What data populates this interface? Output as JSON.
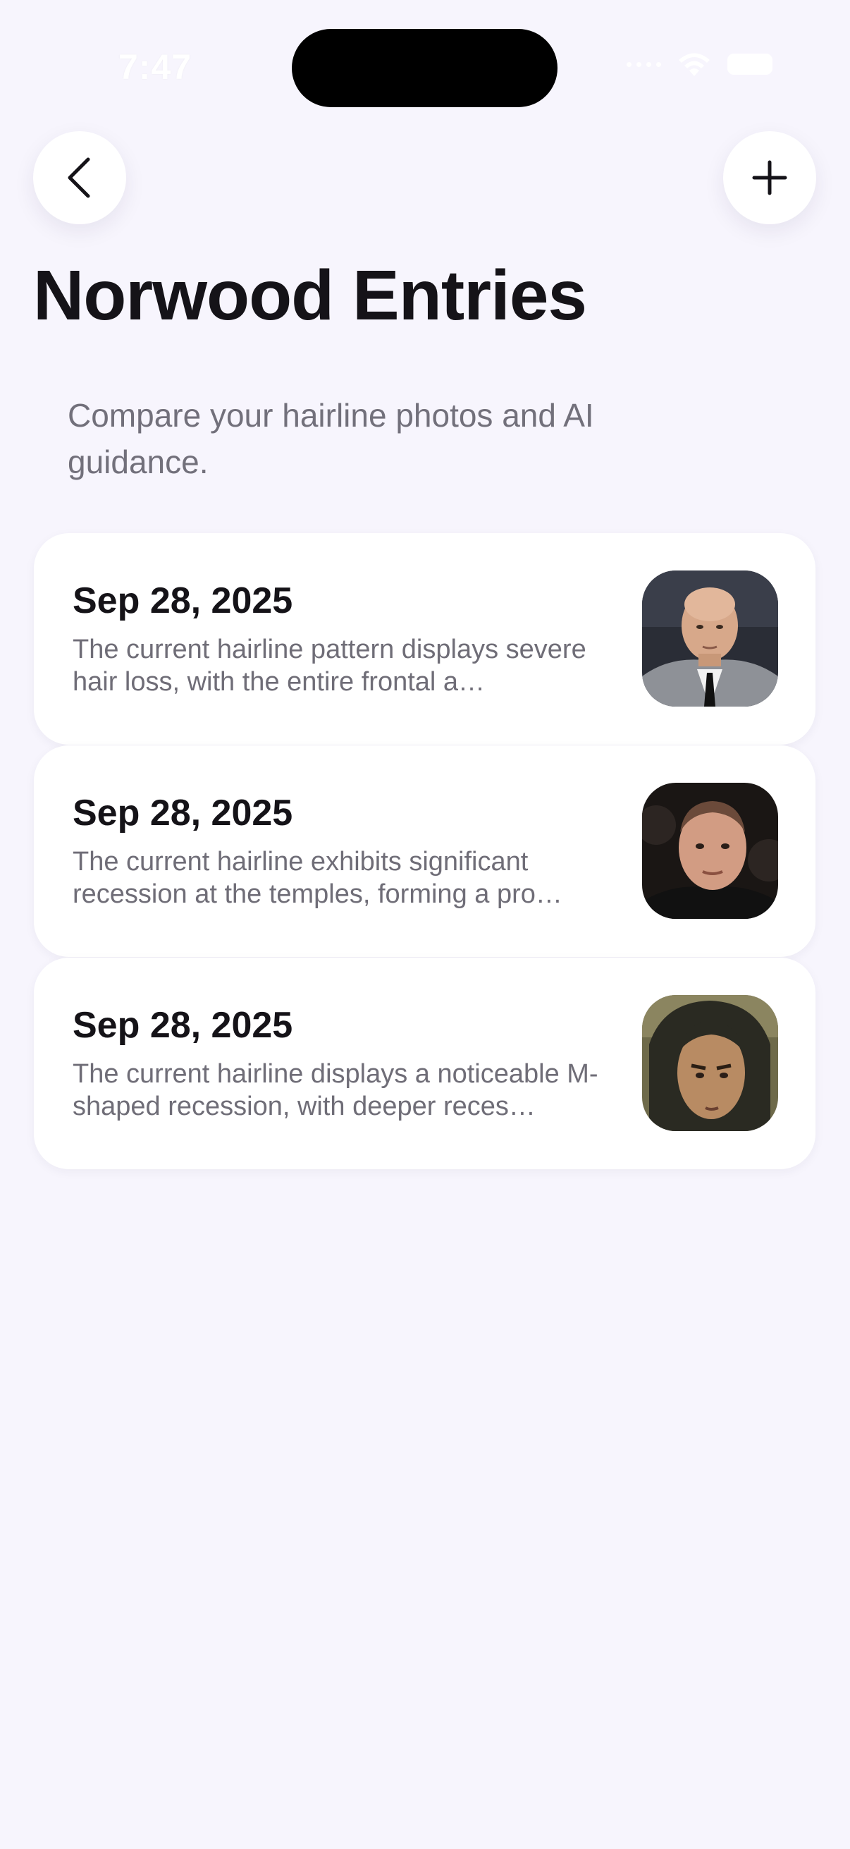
{
  "status_bar": {
    "time": "7:47"
  },
  "nav": {
    "back_icon": "chevron-left-icon",
    "add_icon": "plus-icon"
  },
  "header": {
    "title": "Norwood Entries",
    "subtitle": "Compare your hairline photos and AI guidance."
  },
  "entries": [
    {
      "date": "Sep 28, 2025",
      "summary": "The current hairline pattern displays severe hair loss, with the entire frontal a…",
      "photo": "bald-man-suit-photo"
    },
    {
      "date": "Sep 28, 2025",
      "summary": "The current hairline exhibits significant recession at the temples, forming a pro…",
      "photo": "receding-hairline-photo"
    },
    {
      "date": "Sep 28, 2025",
      "summary": "The current hairline displays a noticeable M-shaped recession, with deeper reces…",
      "photo": "long-hair-man-photo"
    }
  ],
  "colors": {
    "background": "#f7f5fd",
    "card": "#ffffff",
    "title": "#151318",
    "secondary_text": "#6f6d77"
  }
}
